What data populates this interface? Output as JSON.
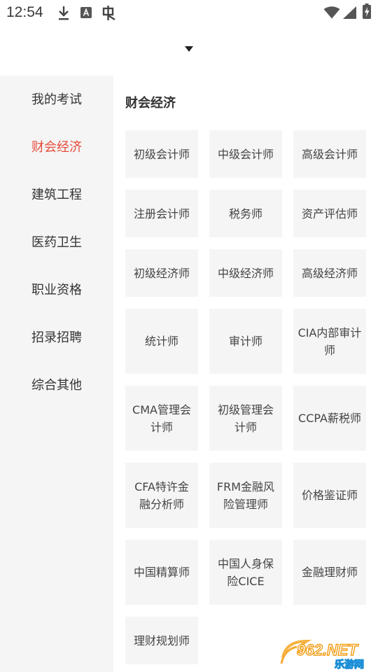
{
  "status_bar": {
    "time": "12:54",
    "icons": [
      "download-icon",
      "text-a-icon",
      "app-notification-icon",
      "wifi-icon",
      "cellular-signal-icon",
      "battery-charging-icon"
    ]
  },
  "sidebar": {
    "items": [
      {
        "label": "我的考试",
        "active": false
      },
      {
        "label": "财会经济",
        "active": true
      },
      {
        "label": "建筑工程",
        "active": false
      },
      {
        "label": "医药卫生",
        "active": false
      },
      {
        "label": "职业资格",
        "active": false
      },
      {
        "label": "招录招聘",
        "active": false
      },
      {
        "label": "综合其他",
        "active": false
      }
    ]
  },
  "main": {
    "section_title": "财会经济",
    "tiles": [
      "初级会计师",
      "中级会计师",
      "高级会计师",
      "注册会计师",
      "税务师",
      "资产评估师",
      "初级经济师",
      "中级经济师",
      "高级经济师",
      "统计师",
      "审计师",
      "CIA内部审计师",
      "CMA管理会计师",
      "初级管理会计师",
      "CCPA薪税师",
      "CFA特许金融分析师",
      "FRM金融风险管理师",
      "价格鉴证师",
      "中国精算师",
      "中国人身保险CICE",
      "金融理财师",
      "理财规划师"
    ]
  },
  "watermark": {
    "logo_text": "962.NET",
    "sub_text": "乐游网"
  },
  "colors": {
    "accent": "#e74c3c",
    "sidebar_bg": "#f5f5f5",
    "tile_bg": "#f5f5f5",
    "text": "#333333"
  }
}
